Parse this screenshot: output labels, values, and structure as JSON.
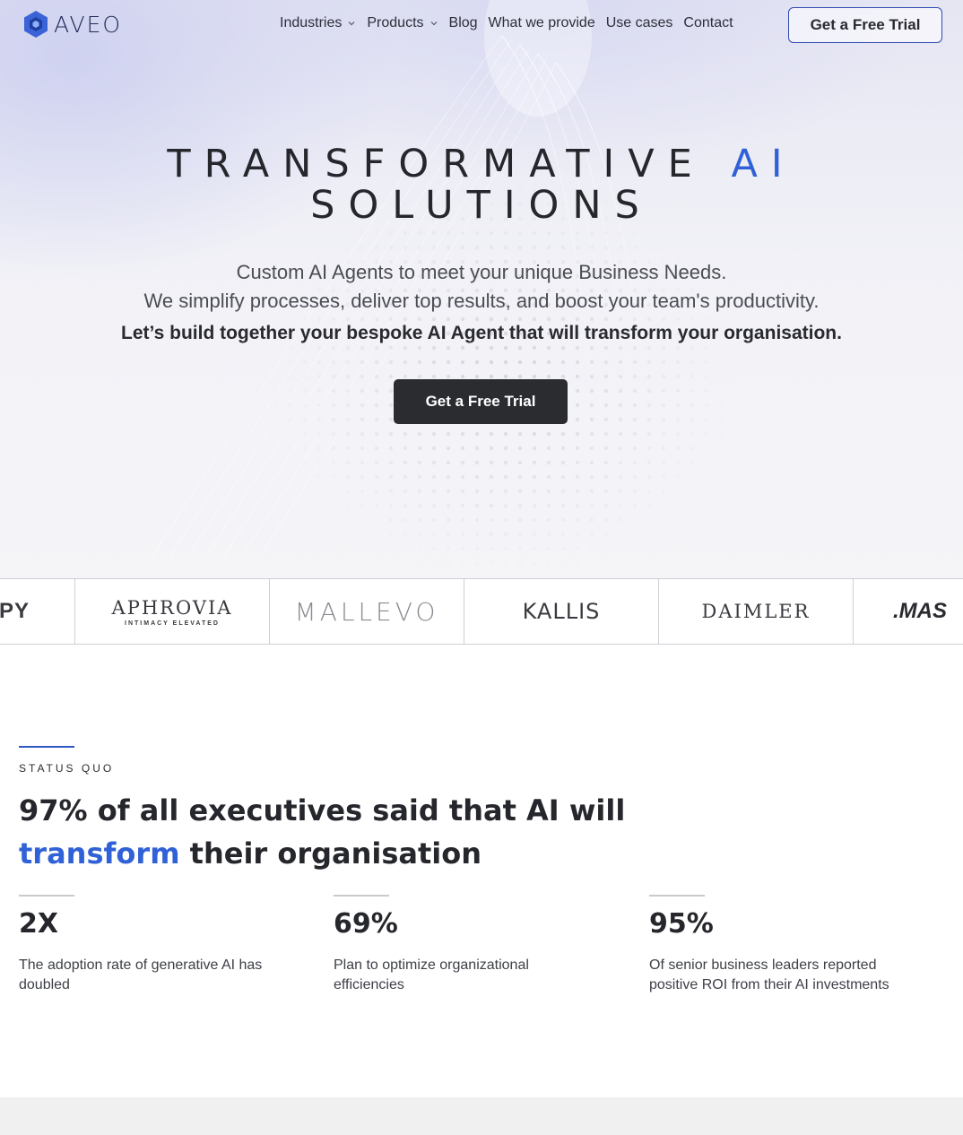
{
  "brand": {
    "name": "AVEO",
    "accent_color": "#3161d6",
    "dark_color": "#2b2c30"
  },
  "nav": {
    "items": [
      {
        "label": "Industries",
        "has_dropdown": true,
        "icon": "chevron-down-icon"
      },
      {
        "label": "Products",
        "has_dropdown": true,
        "icon": "chevron-down-icon"
      },
      {
        "label": "Blog",
        "has_dropdown": false
      },
      {
        "label": "What we provide",
        "has_dropdown": false
      },
      {
        "label": "Use cases",
        "has_dropdown": false
      },
      {
        "label": "Contact",
        "has_dropdown": false
      }
    ],
    "cta_label": "Get a Free Trial"
  },
  "hero": {
    "title_line1": "TRANSFORMATIVE",
    "title_highlight": "AI",
    "title_line2": "SOLUTIONS",
    "subtitle_line1": "Custom AI Agents to meet your unique Business Needs.",
    "subtitle_line2": "We simplify processes, deliver top results, and boost your team's productivity.",
    "emphasis": "Let’s build together your bespoke AI Agent that will transform your organisation.",
    "cta_label": "Get a Free Trial"
  },
  "logos": {
    "items": [
      {
        "text": "PY"
      },
      {
        "text": "APHROVIA",
        "tagline": "INTIMACY ELEVATED"
      },
      {
        "text": "MALLEVO"
      },
      {
        "text": "KALLIS"
      },
      {
        "text": "DAIMLER"
      },
      {
        "text": ".MAS"
      }
    ]
  },
  "status_quo": {
    "eyebrow": "STATUS QUO",
    "heading_part1": "97% of all executives said that AI will",
    "heading_highlight": "transform",
    "heading_part2": "their organisation",
    "stats": [
      {
        "value": "2X",
        "description": "The adoption rate of generative AI has doubled"
      },
      {
        "value": "69%",
        "description": "Plan to optimize organizational efficiencies"
      },
      {
        "value": "95%",
        "description": "Of senior business leaders reported positive ROI from their AI investments"
      }
    ]
  }
}
